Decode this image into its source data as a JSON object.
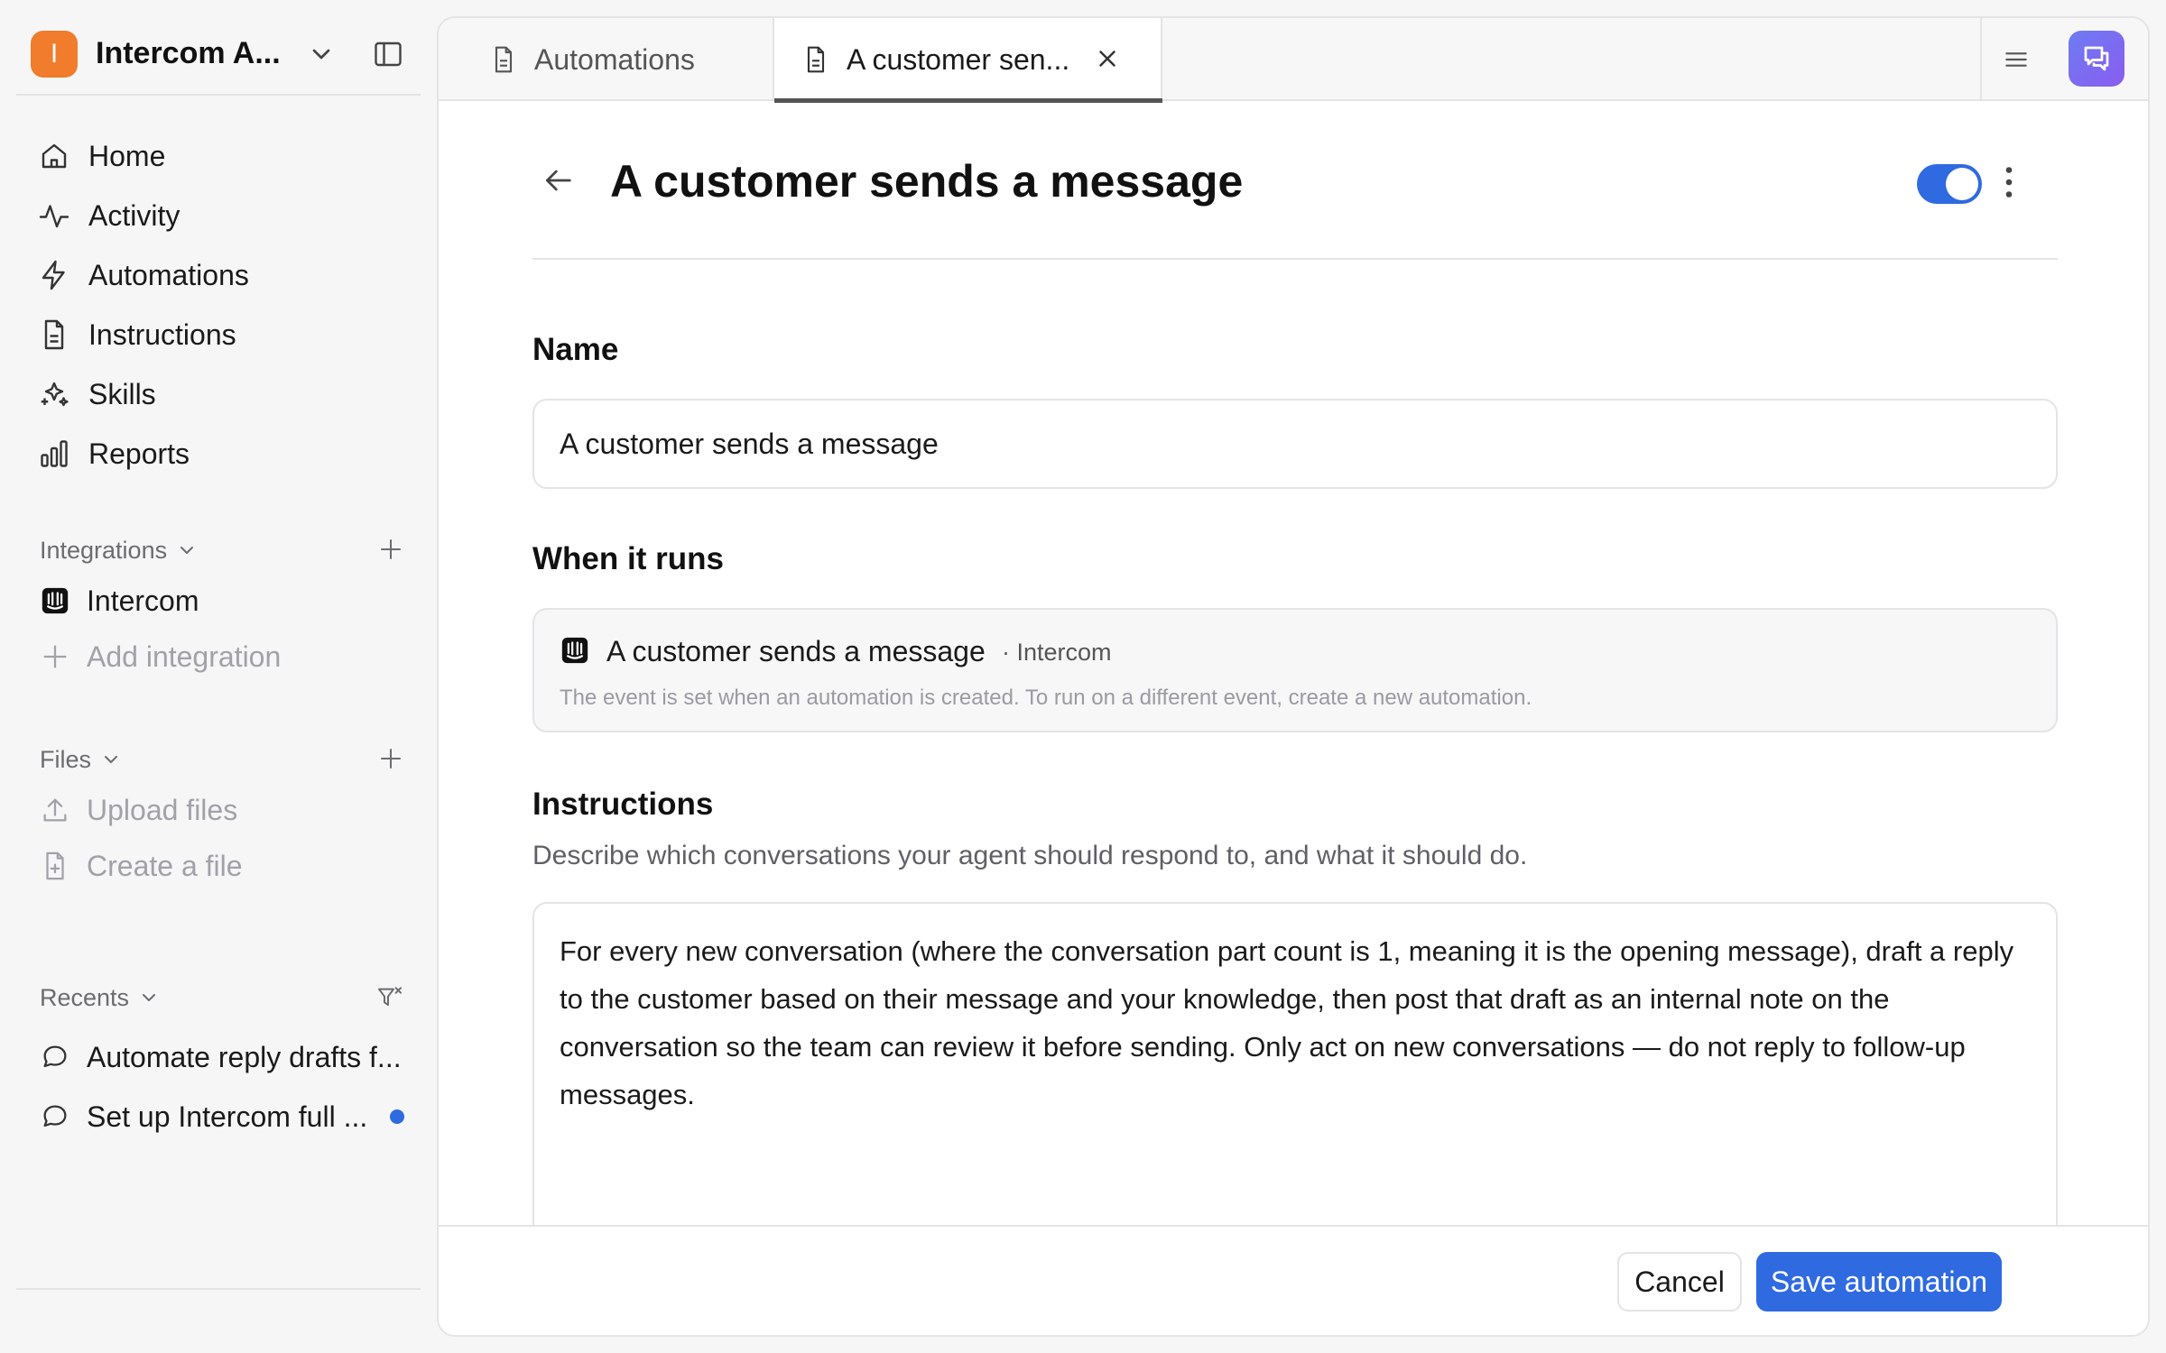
{
  "workspace": {
    "avatar_letter": "I",
    "name": "Intercom A..."
  },
  "nav": [
    {
      "label": "Home",
      "icon": "home-icon"
    },
    {
      "label": "Activity",
      "icon": "activity-icon"
    },
    {
      "label": "Automations",
      "icon": "lightning-icon"
    },
    {
      "label": "Instructions",
      "icon": "document-icon"
    },
    {
      "label": "Skills",
      "icon": "sparkles-icon"
    },
    {
      "label": "Reports",
      "icon": "bar-chart-icon"
    }
  ],
  "integrations": {
    "heading": "Integrations",
    "items": [
      {
        "label": "Intercom",
        "icon": "intercom-logo-icon"
      }
    ],
    "add_label": "Add integration"
  },
  "files": {
    "heading": "Files",
    "upload_label": "Upload files",
    "create_label": "Create a file"
  },
  "recents": {
    "heading": "Recents",
    "items": [
      {
        "label": "Automate reply drafts f...",
        "unread": false
      },
      {
        "label": "Set up Intercom full ...",
        "unread": true
      }
    ]
  },
  "tabs": [
    {
      "label": "Automations",
      "active": false
    },
    {
      "label": "A customer sen...",
      "active": true
    }
  ],
  "page": {
    "title": "A customer sends a message",
    "enabled": true
  },
  "form": {
    "name_label": "Name",
    "name_value": "A customer sends a message",
    "when_label": "When it runs",
    "trigger_title": "A customer sends a message",
    "trigger_source": "· Intercom",
    "trigger_note": "The event is set when an automation is created. To run on a different event, create a new automation.",
    "instructions_label": "Instructions",
    "instructions_description": "Describe which conversations your agent should respond to, and what it should do.",
    "instructions_value": "For every new conversation (where the conversation part count is 1, meaning it is the opening message), draft a reply to the customer based on their message and your knowledge, then post that draft as an internal note on the conversation so the team can review it before sending. Only act on new conversations — do not reply to follow-up messages."
  },
  "footer": {
    "cancel_label": "Cancel",
    "save_label": "Save automation"
  },
  "colors": {
    "accent": "#2f6ae0",
    "workspace_avatar": "#f07c2c",
    "unread_dot": "#2f6ae0"
  }
}
